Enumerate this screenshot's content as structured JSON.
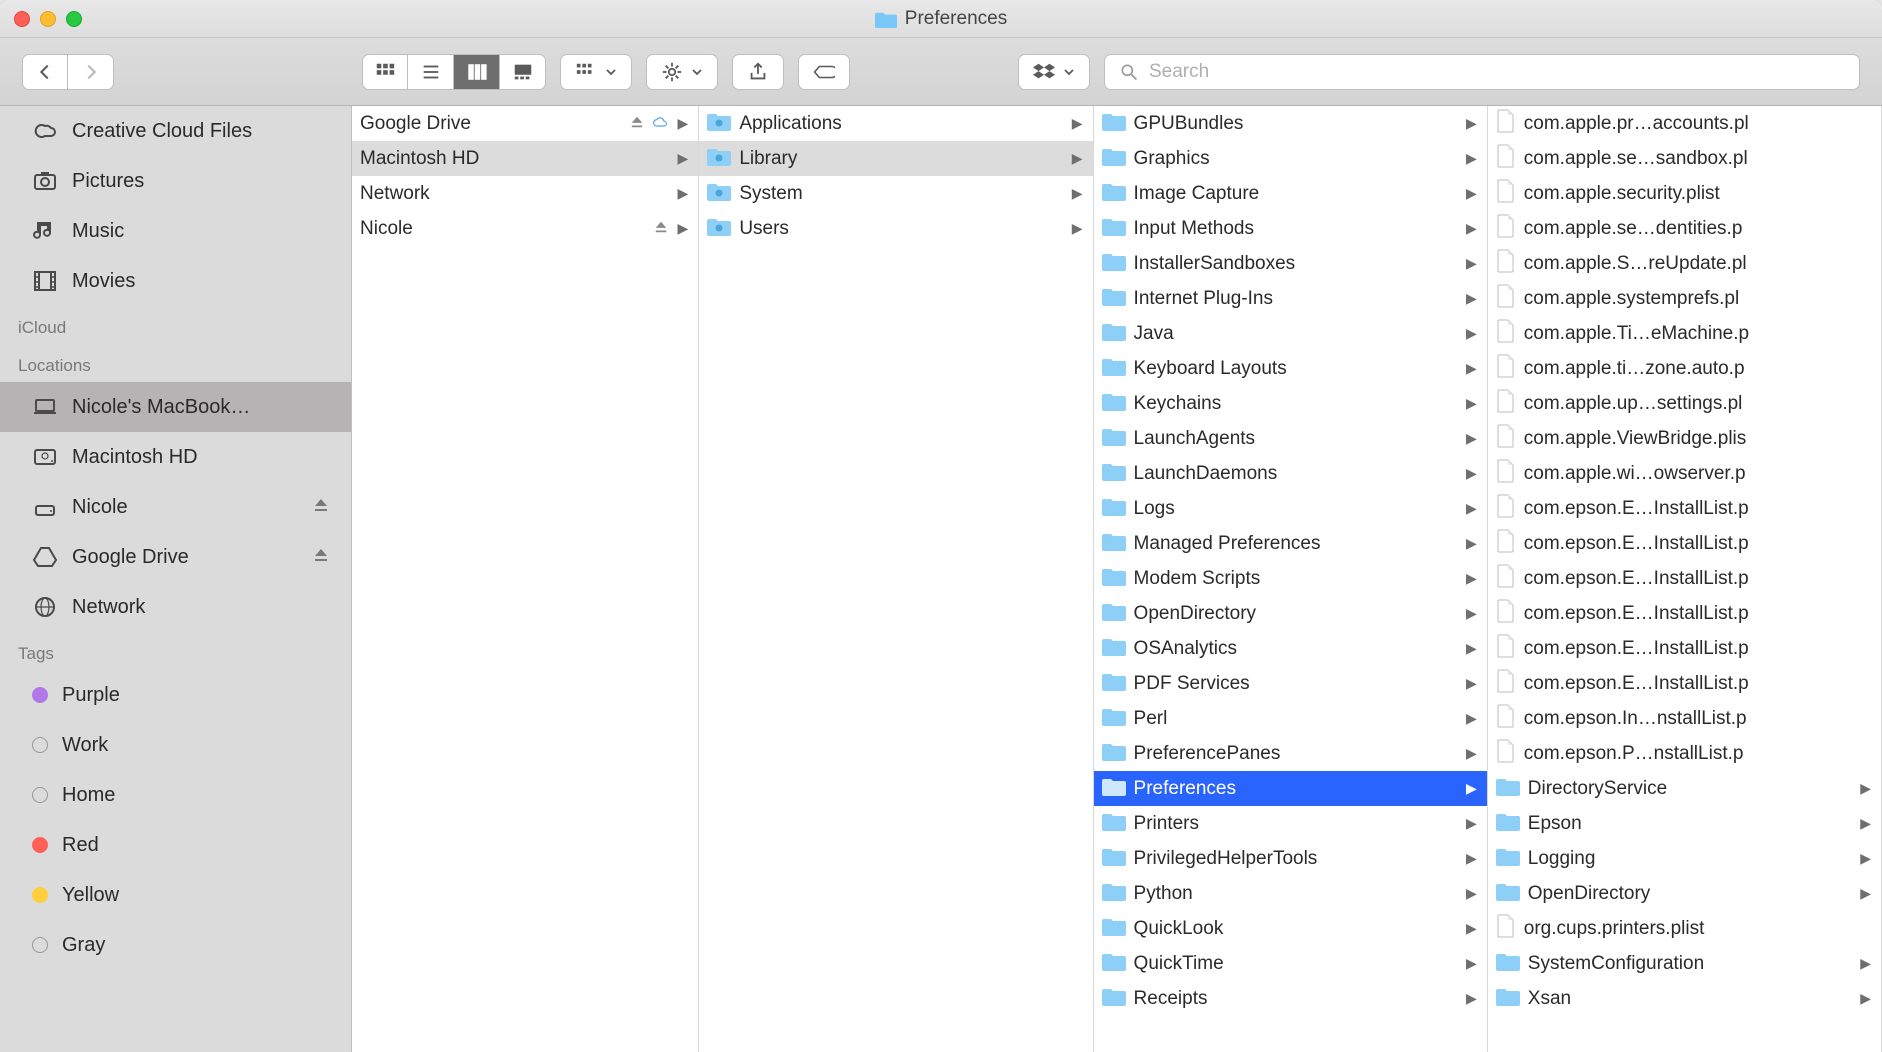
{
  "window": {
    "title": "Preferences"
  },
  "toolbar": {
    "search_placeholder": "Search"
  },
  "sidebar": {
    "top_items": [
      {
        "label": "Creative Cloud Files",
        "icon": "creative-cloud"
      },
      {
        "label": "Pictures",
        "icon": "camera"
      },
      {
        "label": "Music",
        "icon": "music"
      },
      {
        "label": "Movies",
        "icon": "film"
      }
    ],
    "icloud_heading": "iCloud",
    "locations_heading": "Locations",
    "locations": [
      {
        "label": "Nicole's MacBook…",
        "icon": "laptop",
        "selected": true
      },
      {
        "label": "Macintosh HD",
        "icon": "drive"
      },
      {
        "label": "Nicole",
        "icon": "external",
        "eject": true
      },
      {
        "label": "Google Drive",
        "icon": "gdrive",
        "eject": true
      },
      {
        "label": "Network",
        "icon": "globe"
      }
    ],
    "tags_heading": "Tags",
    "tags": [
      {
        "label": "Purple",
        "color": "#b378e8"
      },
      {
        "label": "Work",
        "color": "transparent"
      },
      {
        "label": "Home",
        "color": "transparent"
      },
      {
        "label": "Red",
        "color": "#ff6159"
      },
      {
        "label": "Yellow",
        "color": "#ffcf3a"
      },
      {
        "label": "Gray",
        "color": "transparent"
      }
    ]
  },
  "columns": [
    {
      "items": [
        {
          "label": "Google Drive",
          "type": "plain",
          "eject": true,
          "cloud": true,
          "arrow": true
        },
        {
          "label": "Macintosh HD",
          "type": "plain",
          "arrow": true,
          "selected": "dim"
        },
        {
          "label": "Network",
          "type": "plain",
          "arrow": true
        },
        {
          "label": "Nicole",
          "type": "plain",
          "eject": true,
          "arrow": true
        }
      ]
    },
    {
      "items": [
        {
          "label": "Applications",
          "type": "folder-sys",
          "arrow": true
        },
        {
          "label": "Library",
          "type": "folder-sys",
          "arrow": true,
          "selected": "dim"
        },
        {
          "label": "System",
          "type": "folder-sys",
          "arrow": true
        },
        {
          "label": "Users",
          "type": "folder-sys",
          "arrow": true
        }
      ]
    },
    {
      "items": [
        {
          "label": "GPUBundles",
          "type": "folder",
          "arrow": true
        },
        {
          "label": "Graphics",
          "type": "folder",
          "arrow": true
        },
        {
          "label": "Image Capture",
          "type": "folder",
          "arrow": true
        },
        {
          "label": "Input Methods",
          "type": "folder",
          "arrow": true
        },
        {
          "label": "InstallerSandboxes",
          "type": "folder",
          "arrow": true
        },
        {
          "label": "Internet Plug-Ins",
          "type": "folder",
          "arrow": true
        },
        {
          "label": "Java",
          "type": "folder",
          "arrow": true
        },
        {
          "label": "Keyboard Layouts",
          "type": "folder",
          "arrow": true
        },
        {
          "label": "Keychains",
          "type": "folder",
          "arrow": true
        },
        {
          "label": "LaunchAgents",
          "type": "folder",
          "arrow": true
        },
        {
          "label": "LaunchDaemons",
          "type": "folder",
          "arrow": true
        },
        {
          "label": "Logs",
          "type": "folder",
          "arrow": true
        },
        {
          "label": "Managed Preferences",
          "type": "folder",
          "arrow": true
        },
        {
          "label": "Modem Scripts",
          "type": "folder",
          "arrow": true
        },
        {
          "label": "OpenDirectory",
          "type": "folder",
          "arrow": true
        },
        {
          "label": "OSAnalytics",
          "type": "folder",
          "arrow": true
        },
        {
          "label": "PDF Services",
          "type": "folder",
          "arrow": true
        },
        {
          "label": "Perl",
          "type": "folder",
          "arrow": true
        },
        {
          "label": "PreferencePanes",
          "type": "folder",
          "arrow": true
        },
        {
          "label": "Preferences",
          "type": "folder",
          "arrow": true,
          "selected": "blue"
        },
        {
          "label": "Printers",
          "type": "folder",
          "arrow": true
        },
        {
          "label": "PrivilegedHelperTools",
          "type": "folder",
          "arrow": true
        },
        {
          "label": "Python",
          "type": "folder",
          "arrow": true
        },
        {
          "label": "QuickLook",
          "type": "folder",
          "arrow": true
        },
        {
          "label": "QuickTime",
          "type": "folder",
          "arrow": true
        },
        {
          "label": "Receipts",
          "type": "folder",
          "arrow": true
        }
      ]
    },
    {
      "items": [
        {
          "label": "com.apple.pr…accounts.pl",
          "type": "file"
        },
        {
          "label": "com.apple.se…sandbox.pl",
          "type": "file"
        },
        {
          "label": "com.apple.security.plist",
          "type": "file"
        },
        {
          "label": "com.apple.se…dentities.p",
          "type": "file"
        },
        {
          "label": "com.apple.S…reUpdate.pl",
          "type": "file"
        },
        {
          "label": "com.apple.systemprefs.pl",
          "type": "file"
        },
        {
          "label": "com.apple.Ti…eMachine.p",
          "type": "file"
        },
        {
          "label": "com.apple.ti…zone.auto.p",
          "type": "file"
        },
        {
          "label": "com.apple.up…settings.pl",
          "type": "file"
        },
        {
          "label": "com.apple.ViewBridge.plis",
          "type": "file"
        },
        {
          "label": "com.apple.wi…owserver.p",
          "type": "file"
        },
        {
          "label": "com.epson.E…InstallList.p",
          "type": "file"
        },
        {
          "label": "com.epson.E…InstallList.p",
          "type": "file"
        },
        {
          "label": "com.epson.E…InstallList.p",
          "type": "file"
        },
        {
          "label": "com.epson.E…InstallList.p",
          "type": "file"
        },
        {
          "label": "com.epson.E…InstallList.p",
          "type": "file"
        },
        {
          "label": "com.epson.E…InstallList.p",
          "type": "file"
        },
        {
          "label": "com.epson.In…nstallList.p",
          "type": "file"
        },
        {
          "label": "com.epson.P…nstallList.p",
          "type": "file"
        },
        {
          "label": "DirectoryService",
          "type": "folder",
          "arrow": true
        },
        {
          "label": "Epson",
          "type": "folder",
          "arrow": true
        },
        {
          "label": "Logging",
          "type": "folder",
          "arrow": true
        },
        {
          "label": "OpenDirectory",
          "type": "folder",
          "arrow": true
        },
        {
          "label": "org.cups.printers.plist",
          "type": "file"
        },
        {
          "label": "SystemConfiguration",
          "type": "folder",
          "arrow": true
        },
        {
          "label": "Xsan",
          "type": "folder",
          "arrow": true
        }
      ]
    }
  ]
}
